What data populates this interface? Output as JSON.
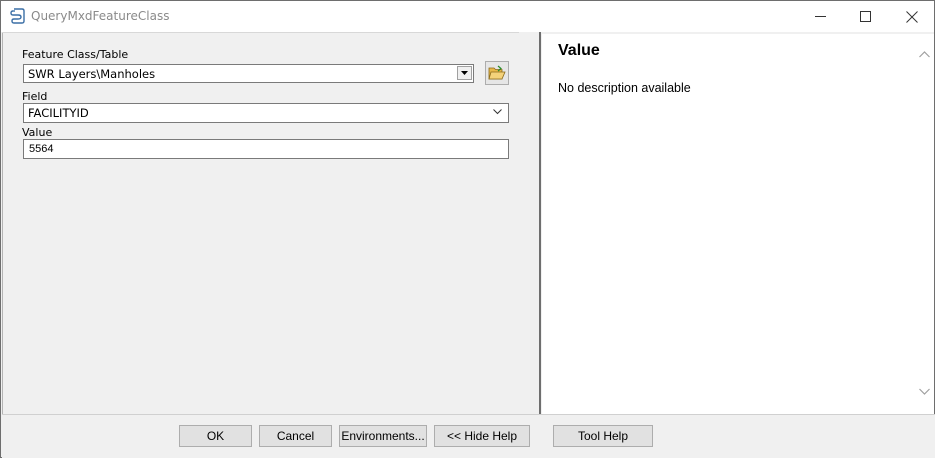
{
  "window": {
    "title": "QueryMxdFeatureClass"
  },
  "params": {
    "feature_class": {
      "label": "Feature Class/Table",
      "value": "SWR Layers\\Manholes"
    },
    "field": {
      "label": "Field",
      "value": "FACILITYID"
    },
    "value": {
      "label": "Value",
      "value": "5564"
    }
  },
  "help": {
    "title": "Value",
    "description": "No description available"
  },
  "buttons": {
    "ok": "OK",
    "cancel": "Cancel",
    "environments": "Environments...",
    "hide_help": "<< Hide Help",
    "tool_help": "Tool Help"
  },
  "icons": {
    "app": "python-script-icon",
    "browse": "open-folder-icon",
    "minimize": "minimize-icon",
    "maximize": "maximize-icon",
    "close": "close-icon"
  },
  "colors": {
    "title_text": "#8a8a8a",
    "folder": "#e8b84a",
    "script_blue": "#3a6ea5"
  }
}
